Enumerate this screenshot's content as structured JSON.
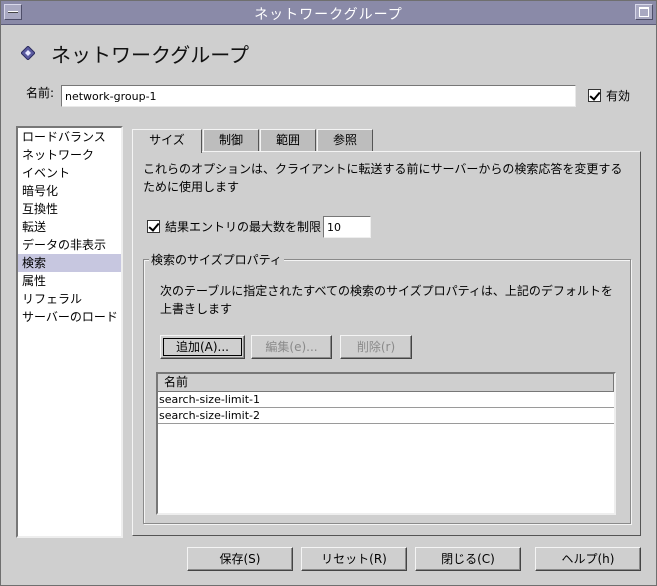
{
  "window": {
    "title": "ネットワークグループ",
    "colors": {
      "titlebar": "#8a8aa8",
      "selection": "#c7c7e0",
      "panel": "#cfcfcf"
    }
  },
  "header": {
    "icon": "diamond-icon",
    "title": "ネットワークグループ"
  },
  "name": {
    "label": "名前:",
    "value": "network-group-1"
  },
  "enabled": {
    "label": "有効",
    "checked": true
  },
  "sidebar": {
    "items": [
      {
        "label": "ロードバランス"
      },
      {
        "label": "ネットワーク"
      },
      {
        "label": "イベント"
      },
      {
        "label": "暗号化"
      },
      {
        "label": "互換性"
      },
      {
        "label": "転送"
      },
      {
        "label": "データの非表示"
      },
      {
        "label": "検索",
        "selected": true
      },
      {
        "label": "属性"
      },
      {
        "label": "リフェラル"
      },
      {
        "label": "サーバーのロード"
      }
    ]
  },
  "tabs": [
    {
      "label": "サイズ",
      "active": true
    },
    {
      "label": "制御"
    },
    {
      "label": "範囲"
    },
    {
      "label": "参照"
    }
  ],
  "size_tab": {
    "description": "これらのオプションは、クライアントに転送する前にサーバーからの検索応答を変更するために使用します",
    "limit_label": "結果エントリの最大数を制限",
    "limit_checked": true,
    "limit_value": "10",
    "group": {
      "title": "検索のサイズプロパティ",
      "description": "次のテーブルに指定されたすべての検索のサイズプロパティは、上記のデフォルトを上書きします",
      "buttons": {
        "add": "追加(A)...",
        "edit": "編集(e)...",
        "delete": "削除(r)"
      },
      "table": {
        "column": "名前",
        "rows": [
          "search-size-limit-1",
          "search-size-limit-2"
        ]
      }
    }
  },
  "footer": {
    "save": "保存(S)",
    "reset": "リセット(R)",
    "close": "閉じる(C)",
    "help": "ヘルプ(h)"
  }
}
